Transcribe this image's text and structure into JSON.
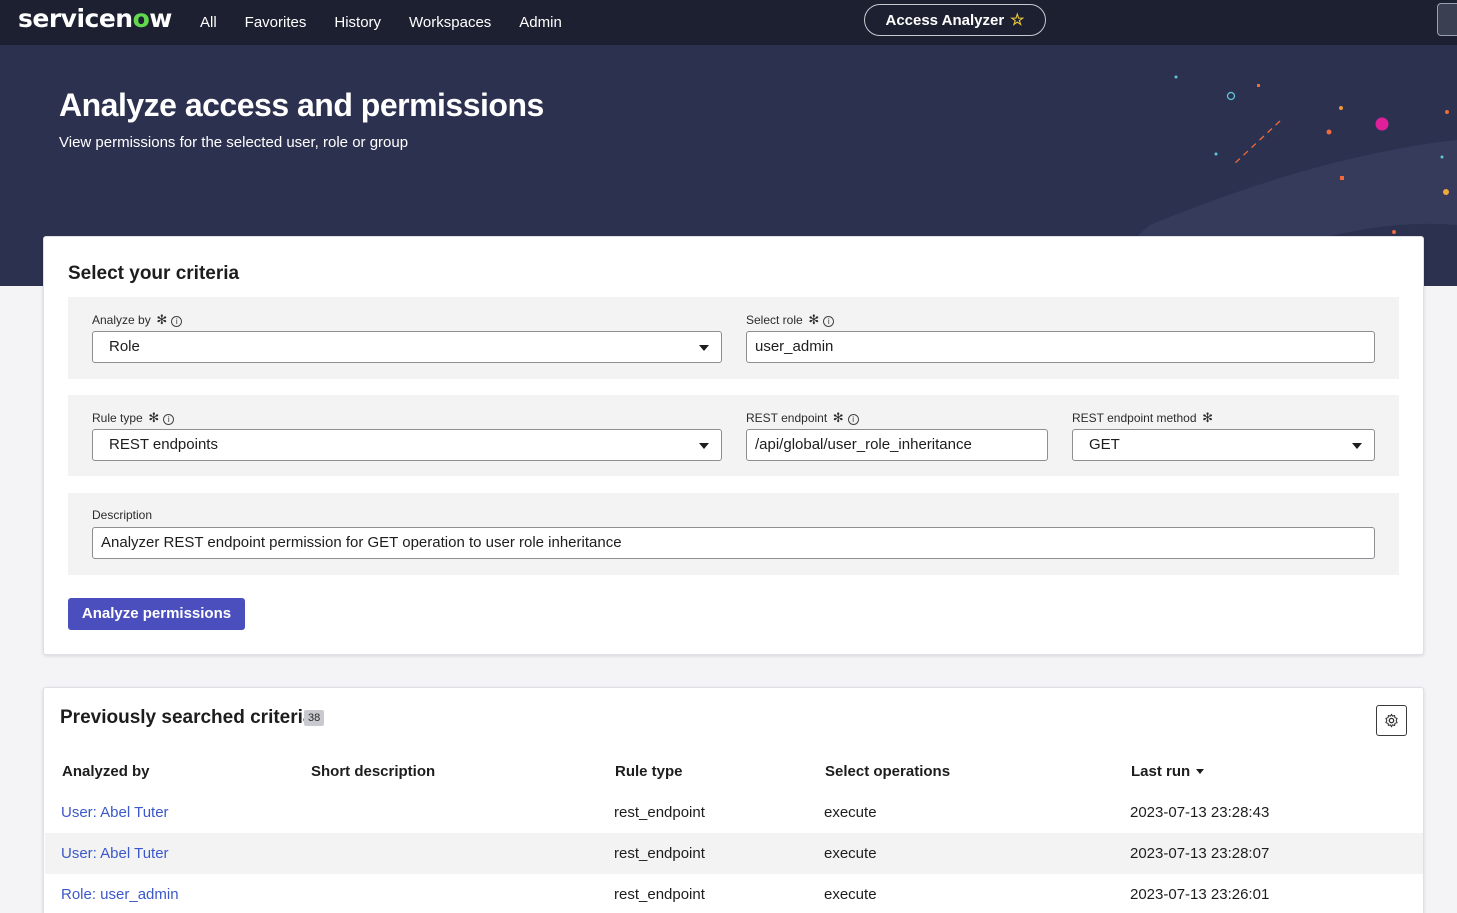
{
  "nav": {
    "logo": "servicenow",
    "links": [
      "All",
      "Favorites",
      "History",
      "Workspaces",
      "Admin"
    ],
    "app_pill": "Access Analyzer"
  },
  "banner": {
    "title": "Analyze access and permissions",
    "subtitle": "View permissions for the selected user, role or group"
  },
  "criteria": {
    "heading": "Select your criteria",
    "analyze_by_label": "Analyze by",
    "analyze_by_value": "Role",
    "select_role_label": "Select role",
    "select_role_value": "user_admin",
    "rule_type_label": "Rule type",
    "rule_type_value": "REST endpoints",
    "rest_endpoint_label": "REST endpoint",
    "rest_endpoint_value": "/api/global/user_role_inheritance",
    "rest_method_label": "REST endpoint method",
    "rest_method_value": "GET",
    "description_label": "Description",
    "description_value": "Analyzer REST endpoint permission for GET operation to user role inheritance",
    "analyze_button": "Analyze permissions"
  },
  "history": {
    "heading": "Previously searched criteria",
    "count": "38",
    "columns": [
      "Analyzed by",
      "Short description",
      "Rule type",
      "Select operations",
      "Last run"
    ],
    "rows": [
      {
        "analyzed_by": "User: Abel Tuter",
        "short_description": "",
        "rule_type": "rest_endpoint",
        "operations": "execute",
        "last_run": "2023-07-13 23:28:43"
      },
      {
        "analyzed_by": "User: Abel Tuter",
        "short_description": "",
        "rule_type": "rest_endpoint",
        "operations": "execute",
        "last_run": "2023-07-13 23:28:07"
      },
      {
        "analyzed_by": "Role: user_admin",
        "short_description": "",
        "rule_type": "rest_endpoint",
        "operations": "execute",
        "last_run": "2023-07-13 23:26:01"
      }
    ]
  },
  "colors": {
    "nav_bg": "#1c2030",
    "banner_bg": "#2d3150",
    "primary_button": "#4b4fbe",
    "link": "#3c58c8",
    "logo_accent": "#62d84e"
  }
}
